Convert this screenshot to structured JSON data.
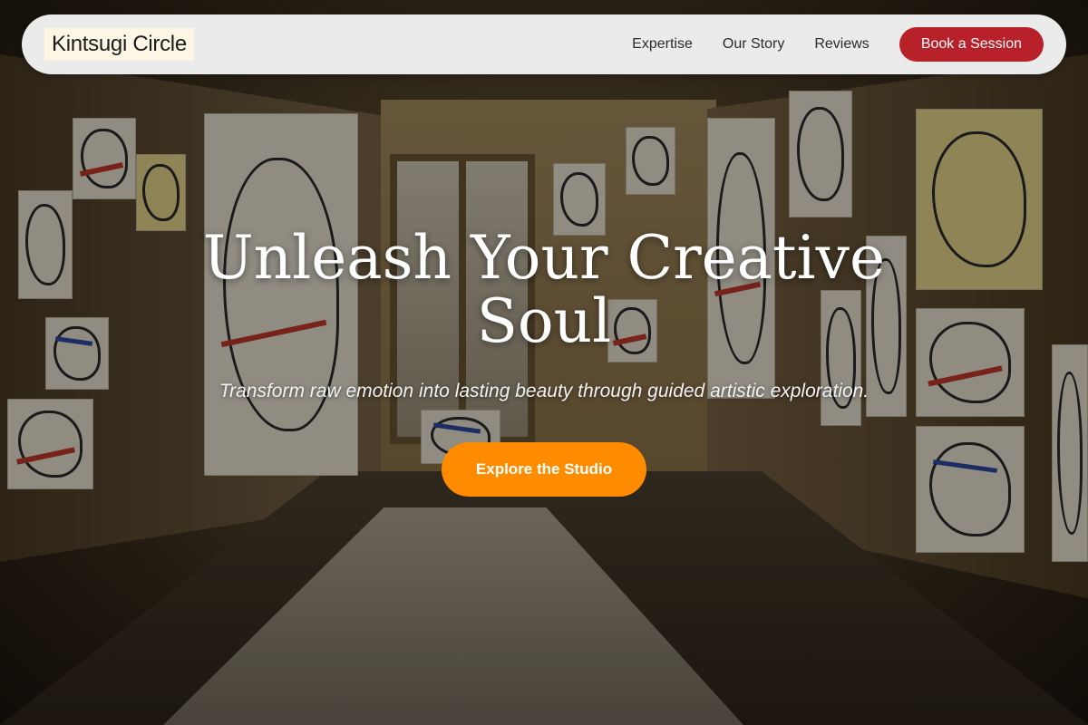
{
  "header": {
    "brand": "Kintsugi Circle",
    "nav": [
      "Expertise",
      "Our Story",
      "Reviews"
    ],
    "cta_label": "Book a Session"
  },
  "hero": {
    "title": "Unleash Your Creative Soul",
    "subtitle": "Transform raw emotion into lasting beauty through guided artistic exploration.",
    "button_label": "Explore the Studio"
  },
  "colors": {
    "nav_background": "#ebebeb",
    "cta_red": "#b8202a",
    "explore_orange": "#ff8c00",
    "hero_text": "#ffffff"
  },
  "background_image": "art studio room with drawings on walls and floor"
}
